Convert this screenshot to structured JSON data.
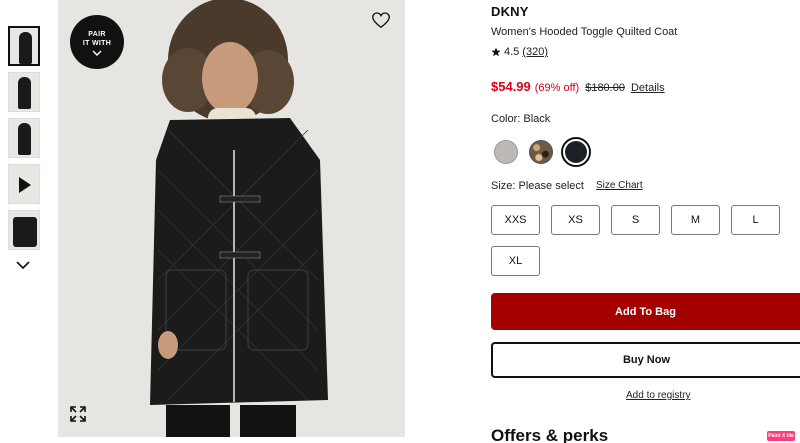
{
  "gallery": {
    "thumbnails": [
      "thumbnail-1",
      "thumbnail-2",
      "thumbnail-3",
      "thumbnail-video",
      "thumbnail-5"
    ],
    "pair_it_with_line1": "PAIR",
    "pair_it_with_line2": "IT WITH"
  },
  "product": {
    "brand": "DKNY",
    "name": "Women's Hooded Toggle Quilted Coat",
    "rating": "4.5",
    "review_count": "(320)",
    "sale_price": "$54.99",
    "discount": "(69% off)",
    "original_price": "$180.00",
    "details_link": "Details",
    "color_label": "Color: Black",
    "swatch_colors": [
      "#bdbab6",
      "#6e5a43",
      "#1d2027"
    ],
    "size_label": "Size: Please select",
    "size_chart_link": "Size Chart",
    "sizes": [
      "XXS",
      "XS",
      "S",
      "M",
      "L",
      "XL"
    ],
    "add_to_bag": "Add To Bag",
    "buy_now": "Buy Now",
    "add_to_registry": "Add to registry",
    "offers_heading": "Offers & perks"
  },
  "overlay": {
    "paint_badge": "Paint X tile"
  },
  "colors": {
    "sale_red": "#d6001c",
    "button_red": "#a50000"
  }
}
